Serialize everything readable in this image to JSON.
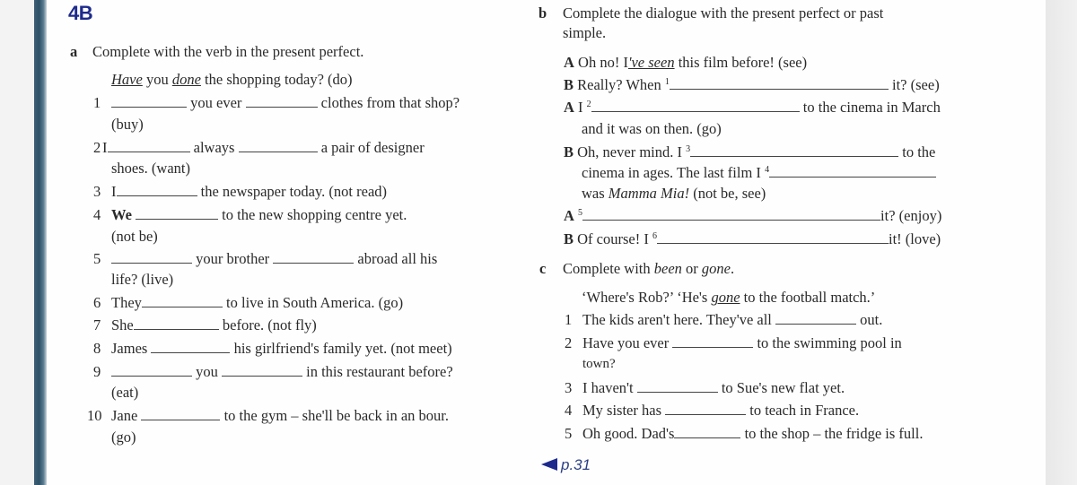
{
  "unit_label": "4B",
  "section_a": {
    "letter": "a",
    "instruction": "Complete with the verb in the present perfect.",
    "example": {
      "have": "Have",
      "you": " you ",
      "done": "done",
      "rest": " the shopping today? (do)"
    },
    "items": [
      {
        "n": "1",
        "p1": "",
        "p2": "you ever",
        "p3": "clothes from that shop?",
        "cont": "(buy)"
      },
      {
        "n": "2",
        "p1": "I",
        "p2": "always",
        "p3": "a pair of designer",
        "cont": "shoes. (want)"
      },
      {
        "n": "3",
        "p1": "I",
        "p2": "the newspaper today. (not read)"
      },
      {
        "n": "4",
        "p1": "We",
        "p2": "to the new shopping centre yet.",
        "cont": "(not be)"
      },
      {
        "n": "5",
        "p1": "",
        "p2": "your brother",
        "p3": "abroad all his",
        "cont": "life? (live)"
      },
      {
        "n": "6",
        "p1": "They",
        "p2": "to live in South America. (go)"
      },
      {
        "n": "7",
        "p1": "She",
        "p2": "before. (not fly)"
      },
      {
        "n": "8",
        "p1": "James",
        "p2": "his girlfriend's family yet. (not meet)"
      },
      {
        "n": "9",
        "p1": "",
        "p2": "you",
        "p3": "in this restaurant before?",
        "cont": "(eat)"
      },
      {
        "n": "10",
        "p1": "Jane",
        "p2": "to the gym – she'll be back in an bour.",
        "cont": "(go)"
      }
    ]
  },
  "section_b": {
    "letter": "b",
    "instruction_line1": "Complete the dialogue with the present perfect or past",
    "instruction_line2": "simple.",
    "lines": [
      {
        "speaker": "A",
        "pre": "Oh no! I",
        "ex": "'ve seen",
        "post": " this film before!  (see)"
      },
      {
        "speaker": "B",
        "pre": "Really? When ",
        "sup": "1",
        "post": "it?  (see)"
      },
      {
        "speaker": "A",
        "pre": "I ",
        "sup": "2",
        "post": "to the cinema in March",
        "cont": "and it was on then. (go)"
      },
      {
        "speaker": "B",
        "pre": "Oh, never mind. I ",
        "sup": "3",
        "post": "to the",
        "cont_pre": "cinema in ages. The last film I ",
        "cont_sup": "4",
        "cont2_pre": "was ",
        "cont2_it": "Mamma Mia!",
        "cont2_post": "  (not be, see)"
      },
      {
        "speaker": "A",
        "pre": "",
        "sup": "5",
        "post": "it? (enjoy)"
      },
      {
        "speaker": "B",
        "pre": "Of course! I ",
        "sup": "6",
        "post": "it! (love)"
      }
    ]
  },
  "section_c": {
    "letter": "c",
    "instruction_pre": "Complete with ",
    "instruction_been": "been",
    "instruction_or": " or ",
    "instruction_gone": "gone",
    "instruction_end": ".",
    "example": {
      "pre": "‘Where's Rob?’ ‘He's ",
      "ex": "gone",
      "post": " to the football match.’"
    },
    "items": [
      {
        "n": "1",
        "p1": "The kids aren't here. They've all",
        "p2": "out."
      },
      {
        "n": "2",
        "p1": "Have you ever",
        "p2": "to the swimming pool in",
        "cont": "town?"
      },
      {
        "n": "3",
        "p1": "I haven't",
        "p2": "to Sue's new flat yet."
      },
      {
        "n": "4",
        "p1": "My sister has",
        "p2": "to teach in France."
      },
      {
        "n": "5",
        "p1": "Oh good. Dad's",
        "p2": "to the shop – the fridge is full."
      }
    ]
  },
  "page_reference": "p.31",
  "colors": {
    "unit_label": "#1d2a8c",
    "spine": "#2d5068",
    "text": "#2a2a2a"
  }
}
